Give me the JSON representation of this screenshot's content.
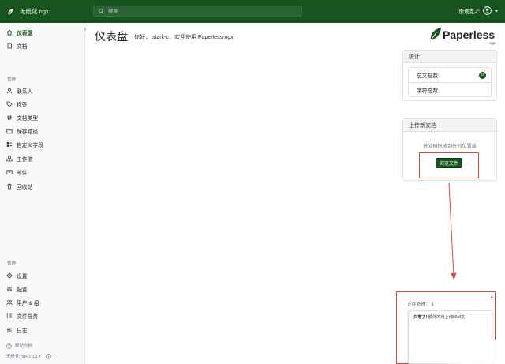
{
  "topbar": {
    "app_title": "无纸化 ngx",
    "search_placeholder": "搜索",
    "user_name": "斯塔克-C",
    "accent": "#17541f"
  },
  "sidebar": {
    "main_items": [
      {
        "label": "仪表盘",
        "icon": "house-icon",
        "active": true
      },
      {
        "label": "文档",
        "icon": "document-icon",
        "active": false
      }
    ],
    "manage_label": "管理",
    "manage_items": [
      {
        "label": "联系人",
        "icon": "person-icon"
      },
      {
        "label": "标签",
        "icon": "tag-icon"
      },
      {
        "label": "文档类型",
        "icon": "hash-icon"
      },
      {
        "label": "保存路径",
        "icon": "folder-icon"
      },
      {
        "label": "自定义字段",
        "icon": "ui-radios-icon"
      },
      {
        "label": "工作流",
        "icon": "boxes-icon"
      },
      {
        "label": "邮件",
        "icon": "envelope-icon"
      },
      {
        "label": "回收站",
        "icon": "trash-icon"
      }
    ],
    "admin_label": "管理",
    "admin_items": [
      {
        "label": "设置",
        "icon": "gear-icon"
      },
      {
        "label": "配置",
        "icon": "sliders-icon"
      },
      {
        "label": "用户 & 组",
        "icon": "people-icon"
      },
      {
        "label": "文件任务",
        "icon": "list-task-icon"
      },
      {
        "label": "日志",
        "icon": "log-icon"
      }
    ],
    "help_label": "帮助文档",
    "version_label": "无纸化 ngx 2.13.4"
  },
  "main": {
    "title": "仪表盘",
    "welcome": "你好， stark-c，欢迎使用 Paperless-ngx",
    "logo_text": "Paperless",
    "logo_sub": "-ngx"
  },
  "stats_card": {
    "header": "统计",
    "total_docs_label": "总文档数:",
    "total_docs_value": "0",
    "char_count_label": "字符总数:"
  },
  "upload_card": {
    "header": "上传新文档",
    "drop_text": "将文档拖放到任何位置或",
    "browse_label": "浏览文件"
  },
  "status": {
    "processing_label": "正在处理： 1",
    "message_bold": "久等了!",
    "message_rest": "额外的待上线55M文"
  }
}
